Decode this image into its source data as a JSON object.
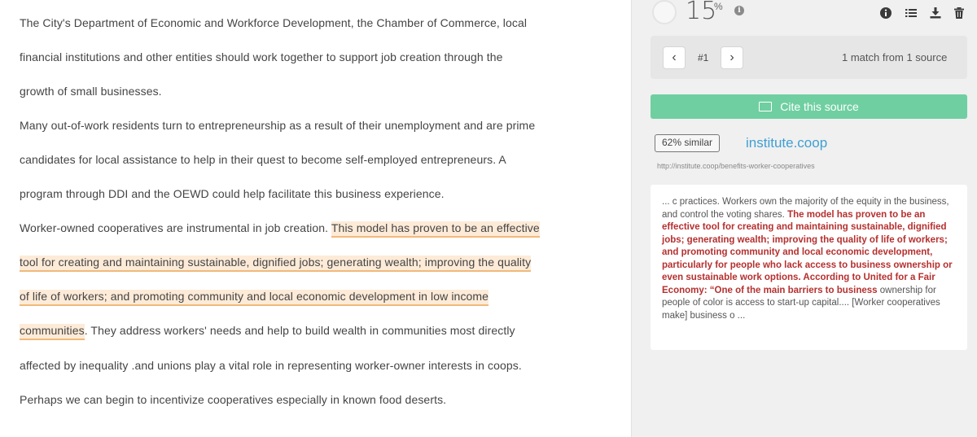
{
  "document": {
    "lines": [
      {
        "text": "The City's Department of Economic and Workforce Development, the Chamber of Commerce, local"
      },
      {
        "text": "financial institutions and other entities should work together to support job creation through the"
      },
      {
        "text": "growth of small businesses."
      },
      {
        "text": "Many out-of-work residents turn to entrepreneurship as a result of their unemployment and are prime"
      },
      {
        "text": "candidates for local assistance to help in their quest to become self-employed entrepreneurs. A"
      },
      {
        "text": "program through DDI and the OEWD could help facilitate this business experience."
      },
      {
        "pre": "Worker-owned cooperatives are instrumental in job creation. ",
        "hl": "This model has proven to be an effective",
        "post": ""
      },
      {
        "pre": "",
        "hl": "tool for creating and maintaining sustainable, dignified jobs; generating wealth; improving the quality",
        "post": ""
      },
      {
        "pre": "",
        "hl": "of life of workers; and promoting community and local economic development in low income",
        "post": ""
      },
      {
        "pre": "",
        "hl": "communities",
        "post": ". They address workers' needs and help to build wealth in communities most directly"
      },
      {
        "text": "affected by inequality .and unions play a vital role in representing worker-owner interests in coops."
      },
      {
        "text": "Perhaps we can begin to incentivize cooperatives especially in known food deserts."
      }
    ]
  },
  "panel": {
    "score": "15",
    "score_unit": "%",
    "match_index": "#1",
    "match_summary": "1 match from 1 source",
    "cite_label": "Cite this source",
    "similar_badge": "62% similar",
    "source_name": "institute.coop",
    "source_url": "http://institute.coop/benefits-worker-cooperatives",
    "excerpt": {
      "pre": "... c practices. Workers own the majority of the equity in the business, and control the voting shares. ",
      "match": "The model has proven to be an effective tool for creating and maintaining sustainable, dignified jobs; generating wealth; improving the quality of life of workers; and promoting community and local economic development, particularly for people who lack access to business ownership or even sustainable work options. According to United for a Fair Economy: “One of the main barriers to business",
      "post": " ownership for people of color is access to start-up capital.... [Worker cooperatives make] business o ..."
    },
    "icons": [
      "info-icon",
      "list-icon",
      "download-icon",
      "trash-icon",
      "chevron-left-icon",
      "chevron-right-icon",
      "citation-icon"
    ]
  },
  "colors": {
    "highlight_bg": "#fdebd8",
    "highlight_underline": "#f0b97a",
    "cite_button": "#6fcfa1",
    "source_link": "#3f9fd3",
    "match_text": "#b5302f"
  }
}
